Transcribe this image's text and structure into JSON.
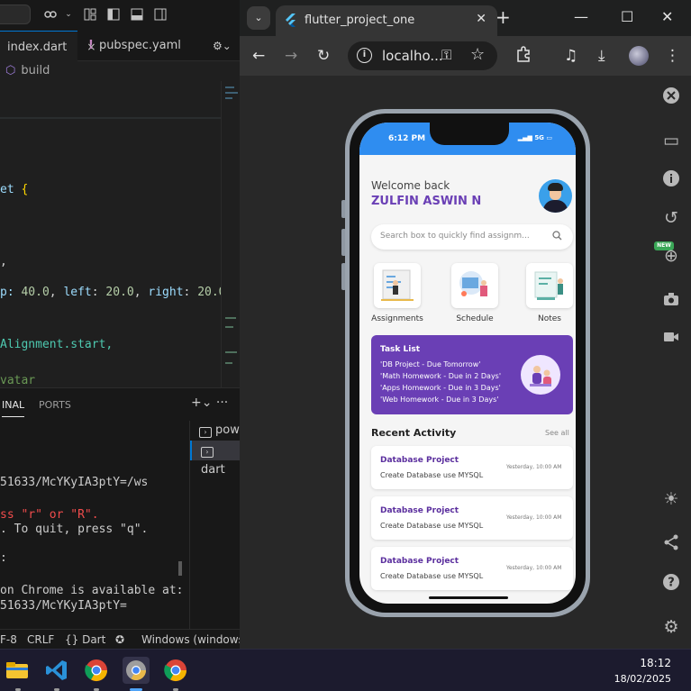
{
  "vscode": {
    "tabs": [
      {
        "label": "index.dart",
        "close": "×"
      },
      {
        "label": "pubspec.yaml",
        "marker": "!"
      }
    ],
    "breadcrumb": "build",
    "code_lines": [
      {
        "pre": "et ",
        "brace": "{"
      },
      {
        "text": ","
      },
      {
        "pre": "p: ",
        "n1": "40.0",
        "m1": ", ",
        "k1": "left",
        "m2": ": ",
        "n2": "20.0",
        "m3": ", ",
        "k2": "right",
        "m4": ": ",
        "n3": "20.0"
      },
      {
        "text": "Alignment.start,"
      },
      {
        "text": "vatar"
      }
    ],
    "panel_tabs": [
      "INAL",
      "PORTS"
    ],
    "panel_actions": "+⌄  ···",
    "terminal_lines": [
      "51633/McYKyIA3ptY=/ws",
      "ss \"r\" or \"R\".",
      ". To quit, press \"q\".",
      ":",
      "on Chrome is available at:",
      "51633/McYKyIA3ptY="
    ],
    "terminal_list": [
      "pow",
      "dart"
    ],
    "status": {
      "encoding": "F-8",
      "eol": "CRLF",
      "lang": "{} Dart",
      "platform": "Windows (windows-"
    }
  },
  "chrome": {
    "tab_title": "flutter_project_one",
    "url": "localho...",
    "window_buttons": [
      "—",
      "☐",
      "✕"
    ]
  },
  "app": {
    "status_time": "6:12 PM",
    "status_right": "5G",
    "welcome": "Welcome back",
    "username": "ZULFIN ASWIN N",
    "search_placeholder": "Search box to quickly find assignm...",
    "menu": [
      "Assignments",
      "Schedule",
      "Notes"
    ],
    "task_list": {
      "title": "Task List",
      "items": [
        "'DB Project - Due Tomorrow'",
        "'Math Homework - Due in 2 Days'",
        "'Apps Homework - Due in 3 Days'",
        "'Web Homework - Due in 3 Days'"
      ]
    },
    "recent_title": "Recent Activity",
    "see_all": "See all",
    "activities": [
      {
        "title": "Database Project",
        "desc": "Create Database use MYSQL",
        "time": "Yesterday, 10:00 AM"
      },
      {
        "title": "Database Project",
        "desc": "Create Database use MYSQL",
        "time": "Yesterday, 10:00 AM"
      },
      {
        "title": "Database Project",
        "desc": "Create Database use MYSQL",
        "time": "Yesterday, 10:00 AM"
      }
    ]
  },
  "devtools": {
    "new_badge": "NEW"
  },
  "taskbar": {
    "time": "18:12",
    "date": "18/02/2025"
  },
  "colors": {
    "accent": "#6a3fb5",
    "statusbar": "#2f8df0",
    "vscode_accent": "#0078d4"
  }
}
